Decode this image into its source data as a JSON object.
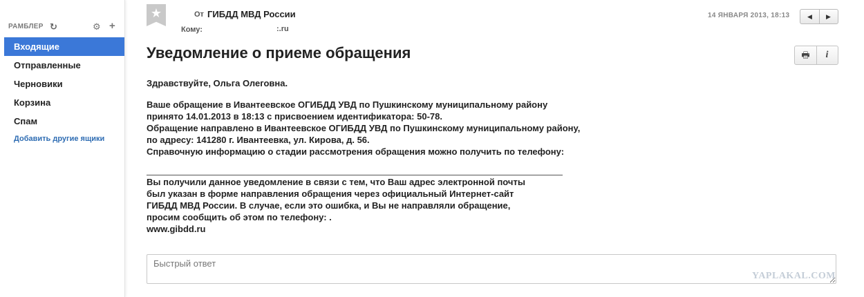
{
  "sidebar": {
    "brand": "РАМБЛЕР",
    "refresh_icon": "↻",
    "settings_icon": "⚙",
    "add_icon": "+",
    "folders": [
      {
        "label": "Входящие",
        "active": true
      },
      {
        "label": "Отправленные"
      },
      {
        "label": "Черновики"
      },
      {
        "label": "Корзина"
      },
      {
        "label": "Спам"
      }
    ],
    "add_mailboxes": "Добавить другие ящики"
  },
  "message": {
    "bookmark_icon": "★",
    "from_label": "От",
    "from": "ГИБДД МВД России",
    "to_label": "Кому:",
    "to": ":.ru",
    "date": "14 ЯНВАРЯ 2013, 18:13",
    "prev_icon": "◀",
    "next_icon": "▶",
    "subject": "Уведомление о приеме обращения",
    "print_icon": "🖶",
    "info_icon": "i",
    "greeting": "Здравствуйте, Ольга Олеговна.",
    "paragraph1": [
      "Ваше обращение в Ивантеевское ОГИБДД УВД по Пушкинскому муниципальному району",
      "принято 14.01.2013 в 18:13 с присвоением идентификатора: 50-78.",
      "Обращение направлено в Ивантеевское ОГИБДД УВД по Пушкинскому муниципальному району,",
      "по адресу: 141280 г. Ивантеевка, ул. Кирова, д. 56.",
      "Справочную информацию о стадии рассмотрения обращения можно получить по телефону:"
    ],
    "paragraph2": [
      "Вы получили данное уведомление в связи с тем, что Ваш адрес электронной почты",
      "был указан в форме направления обращения через официальный Интернет-сайт",
      "ГИБДД МВД России. В случае, если это ошибка, и Вы не направляли обращение,",
      "просим сообщить об этом по телефону: .",
      "www.gibdd.ru"
    ]
  },
  "quick_reply": {
    "placeholder": "Быстрый ответ",
    "value": ""
  },
  "watermark": "YAPLAKAL.COM"
}
